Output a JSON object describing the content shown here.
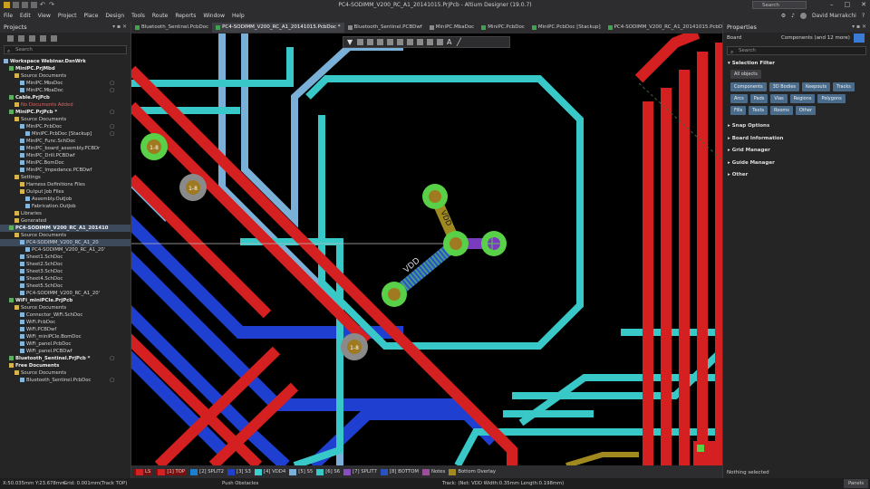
{
  "window": {
    "title": "PC4-SODIMM_V200_RC_A1_20141015.PrjPcb - Altium Designer (19.0.7)",
    "search_placeholder": "Search",
    "minimize": "–",
    "maximize": "□",
    "close": "✕"
  },
  "menu": [
    "File",
    "Edit",
    "View",
    "Project",
    "Place",
    "Design",
    "Tools",
    "Route",
    "Reports",
    "Window",
    "Help"
  ],
  "user": "David Marrakchi",
  "projects_panel": {
    "title": "Projects",
    "search_placeholder": "Search",
    "tree": [
      {
        "label": "Workspace Webinar.DsnWrk",
        "indent": 0,
        "bold": true,
        "icon": "workspace"
      },
      {
        "label": "MiniPC.PrjMbd",
        "indent": 1,
        "bold": true,
        "icon": "project"
      },
      {
        "label": "Source Documents",
        "indent": 2,
        "icon": "folder"
      },
      {
        "label": "MiniPC.MbsDoc",
        "indent": 3,
        "icon": "doc",
        "mark": "□"
      },
      {
        "label": "MiniPC.MbaDoc",
        "indent": 3,
        "icon": "doc",
        "mark": "□"
      },
      {
        "label": "Cable.PrjPcb",
        "indent": 1,
        "bold": true,
        "icon": "project"
      },
      {
        "label": "No Documents Added",
        "indent": 2,
        "icon": "folder",
        "red": true
      },
      {
        "label": "MiniPC.PrjPcb *",
        "indent": 1,
        "bold": true,
        "icon": "project",
        "mark": "□"
      },
      {
        "label": "Source Documents",
        "indent": 2,
        "icon": "folder"
      },
      {
        "label": "MiniPC.PcbDoc",
        "indent": 3,
        "icon": "doc",
        "mark": "□"
      },
      {
        "label": "MiniPC.PcbDoc [Stackup]",
        "indent": 4,
        "icon": "doc",
        "mark": "□"
      },
      {
        "label": "MiniPC_Func.SchDoc",
        "indent": 3,
        "icon": "doc"
      },
      {
        "label": "MiniPC_board_assembly.PCBDr",
        "indent": 3,
        "icon": "doc"
      },
      {
        "label": "MiniPC_Drill.PCBDwf",
        "indent": 3,
        "icon": "doc"
      },
      {
        "label": "MiniPC.BomDoc",
        "indent": 3,
        "icon": "doc"
      },
      {
        "label": "MiniPC_Impedance.PCBDwf",
        "indent": 3,
        "icon": "doc"
      },
      {
        "label": "Settings",
        "indent": 2,
        "icon": "folder"
      },
      {
        "label": "Harness Definitions Files",
        "indent": 3,
        "icon": "folder"
      },
      {
        "label": "Output Job Files",
        "indent": 3,
        "icon": "folder"
      },
      {
        "label": "Assembly.OutJob",
        "indent": 4,
        "icon": "doc"
      },
      {
        "label": "Fabrication.OutJob",
        "indent": 4,
        "icon": "doc"
      },
      {
        "label": "Libraries",
        "indent": 2,
        "icon": "folder"
      },
      {
        "label": "Generated",
        "indent": 2,
        "icon": "folder"
      },
      {
        "label": "PC4-SODIMM_V200_RC_A1_201410",
        "indent": 1,
        "bold": true,
        "icon": "project",
        "selected": true
      },
      {
        "label": "Source Documents",
        "indent": 2,
        "icon": "folder"
      },
      {
        "label": "PC4-SODIMM_V200_RC_A1_20",
        "indent": 3,
        "icon": "doc",
        "selected": true
      },
      {
        "label": "PC4-SODIMM_V200_RC_A1_20'",
        "indent": 4,
        "icon": "doc"
      },
      {
        "label": "Sheet1.SchDoc",
        "indent": 3,
        "icon": "doc"
      },
      {
        "label": "Sheet2.SchDoc",
        "indent": 3,
        "icon": "doc"
      },
      {
        "label": "Sheet3.SchDoc",
        "indent": 3,
        "icon": "doc"
      },
      {
        "label": "Sheet4.SchDoc",
        "indent": 3,
        "icon": "doc"
      },
      {
        "label": "Sheet5.SchDoc",
        "indent": 3,
        "icon": "doc"
      },
      {
        "label": "PC4-SODIMM_V200_RC_A1_20'",
        "indent": 3,
        "icon": "doc"
      },
      {
        "label": "WiFi_miniPCIe.PrjPcb",
        "indent": 1,
        "bold": true,
        "icon": "project"
      },
      {
        "label": "Source Documents",
        "indent": 2,
        "icon": "folder"
      },
      {
        "label": "Connector_WiFi.SchDoc",
        "indent": 3,
        "icon": "doc"
      },
      {
        "label": "WiFi.PcbDoc",
        "indent": 3,
        "icon": "doc"
      },
      {
        "label": "WiFi.PCBDwf",
        "indent": 3,
        "icon": "doc"
      },
      {
        "label": "WiFi_miniPCIe.BomDoc",
        "indent": 3,
        "icon": "doc"
      },
      {
        "label": "WiFi_panel.PcbDoc",
        "indent": 3,
        "icon": "doc"
      },
      {
        "label": "WiFi_panel.PCBDwf",
        "indent": 3,
        "icon": "doc"
      },
      {
        "label": "Bluetooth_Sentinel.PrjPcb *",
        "indent": 1,
        "bold": true,
        "icon": "project",
        "mark": "□"
      },
      {
        "label": "Free Documents",
        "indent": 1,
        "bold": true,
        "icon": "folder"
      },
      {
        "label": "Source Documents",
        "indent": 2,
        "icon": "folder"
      },
      {
        "label": "Bluetooth_Sentinel.PcbDoc",
        "indent": 3,
        "icon": "doc",
        "mark": "□"
      }
    ]
  },
  "tabs": [
    {
      "label": "Bluetooth_Sentinel.PcbDoc",
      "color": "#3fa34d"
    },
    {
      "label": "PC4-SODIMM_V200_RC_A1_20141015.PcbDoc *",
      "color": "#3fa34d",
      "active": true
    },
    {
      "label": "Bluetooth_Sentinel.PCBDwf",
      "color": "#8a8a8a"
    },
    {
      "label": "MiniPC.MbaDoc",
      "color": "#8a8a8a"
    },
    {
      "label": "MiniPC.PcbDoc",
      "color": "#3fa34d"
    },
    {
      "label": "MiniPC.PcbDoc [Stackup]",
      "color": "#3fa34d"
    },
    {
      "label": "PC4-SODIMM_V200_RC_A1_20141015.PcbDoc [Stackup]",
      "color": "#3fa34d"
    }
  ],
  "canvas": {
    "via_labels": [
      "1-8",
      "1-8",
      "1-8",
      "1-8"
    ],
    "net_label": "VDD"
  },
  "layers": [
    {
      "label": "LS",
      "color": "#d42020",
      "active": true
    },
    {
      "label": "[1] TOP",
      "color": "#d42020",
      "active": true
    },
    {
      "label": "[2] SPLIT2",
      "color": "#1a7fcf"
    },
    {
      "label": "[3] S3",
      "color": "#1e3fcf"
    },
    {
      "label": "[4] VDD4",
      "color": "#3ccfcf"
    },
    {
      "label": "[5] S5",
      "color": "#7ab0d8"
    },
    {
      "label": "[6] S6",
      "color": "#38c8c8"
    },
    {
      "label": "[7] SPLIT7",
      "color": "#8a4fbf"
    },
    {
      "label": "[8] BOTTOM",
      "color": "#2a52be"
    },
    {
      "label": "Notes",
      "color": "#9a4f9a"
    },
    {
      "label": "Bottom Overlay",
      "color": "#a08a20"
    }
  ],
  "properties": {
    "title": "Properties",
    "board_label": "Board",
    "components_label": "Components (and 12 more)",
    "search_placeholder": "Search",
    "selection_filter_title": "Selection Filter",
    "all_objects": "All objects",
    "filter_chips": [
      "Components",
      "3D Bodies",
      "Keepouts",
      "Tracks",
      "Arcs",
      "Pads",
      "Vias",
      "Regions",
      "Polygons",
      "Fills",
      "Texts",
      "Rooms",
      "Other"
    ],
    "collapsed_sections": [
      "Snap Options",
      "Board Information",
      "Grid Manager",
      "Guide Manager",
      "Other"
    ],
    "status": "Nothing selected"
  },
  "statusbar": {
    "coords": "X:50.035mm Y:23.678mm",
    "grid": "Grid: 0.001mm",
    "snap": "(Track TOP)",
    "mode": "Push Obstacles",
    "track": "Track: (Net: VDD Width:0.35mm Length:0.198mm)",
    "panels": "Panels"
  }
}
